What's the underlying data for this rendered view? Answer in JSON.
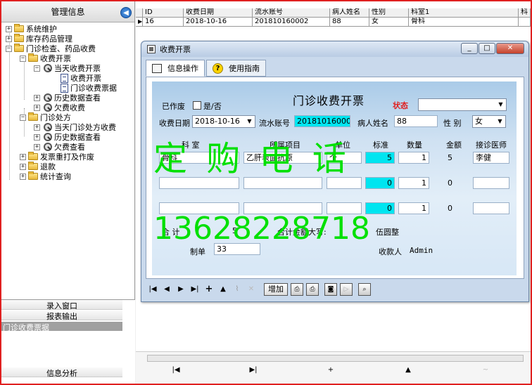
{
  "left_panel": {
    "title": "管理信息",
    "collapse_icon": "chevron-left-icon",
    "tree": {
      "system": "系统维护",
      "drug_stock": "库存药品管理",
      "clinic": "门诊检查、药品收费",
      "charge": "收费开票",
      "today_invoice": "当天收费开票",
      "invoice_entry": "收费开票",
      "invoice_data": "门诊收费票据",
      "history": "历史数据查看",
      "arrears_charge": "欠费收费",
      "prescription": "门诊处方",
      "today_prescription": "当天门诊处方收费",
      "history2": "历史数据查看",
      "arrears_view": "欠费查看",
      "reprint": "发票重打及作废",
      "refund": "退款",
      "stats": "统计查询"
    },
    "bottom": {
      "entry_window": "录入窗口",
      "report_output": "报表输出",
      "selected": "门诊收费票据",
      "info_analysis": "信息分析"
    }
  },
  "grid": {
    "columns": [
      "ID",
      "收费日期",
      "流水账号",
      "病人姓名",
      "性别",
      "科室1",
      "科"
    ],
    "row": {
      "id": "16",
      "date": "2018-10-16",
      "serial": "201810160002",
      "name": "88",
      "gender": "女",
      "dept": "骨科",
      "extra": ""
    },
    "nav": [
      "|◀",
      "▶|",
      "+",
      "▲",
      "~"
    ]
  },
  "dialog": {
    "title": "收费开票",
    "tabs": [
      "信息操作",
      "使用指南"
    ],
    "form": {
      "title": "门诊收费开票",
      "voided_label": "已作废",
      "voided_value": "是/否",
      "status_label": "状态",
      "status_value": "",
      "date_label": "收费日期",
      "date_value": "2018-10-16",
      "serial_label": "流水账号",
      "serial_value": "201810160002",
      "patient_label": "病人姓名",
      "patient_value": "88",
      "gender_label": "性  别",
      "gender_value": "女",
      "headers": [
        "科  室",
        "所属项目",
        "单位",
        "标准",
        "数量",
        "金额",
        "接诊医师"
      ],
      "rows": [
        {
          "dept": "骨科",
          "item": "乙肝表面抗原",
          "unit": "个",
          "standard": "5",
          "qty": "1",
          "amount": "5",
          "doctor": "李健"
        },
        {
          "dept": "",
          "item": "",
          "unit": "",
          "standard": "0",
          "qty": "1",
          "amount": "0",
          "doctor": ""
        },
        {
          "dept": "",
          "item": "",
          "unit": "",
          "standard": "0",
          "qty": "1",
          "amount": "0",
          "doctor": ""
        }
      ],
      "total_label": "合    计",
      "total_value": "5",
      "total_upper_label": "合计金额大写:",
      "total_upper_value": "伍圆整",
      "maker_label": "制单",
      "maker_value": "33",
      "cashier_label": "收款人",
      "cashier_value": "Admin"
    },
    "toolbar": {
      "first": "|◀",
      "prev": "◀",
      "next": "▶",
      "last": "▶|",
      "add_icon": "+",
      "up_icon": "▲",
      "add_button": "增加"
    }
  },
  "watermark": {
    "line1": "定 购 电 话",
    "line2": "13628228718"
  }
}
